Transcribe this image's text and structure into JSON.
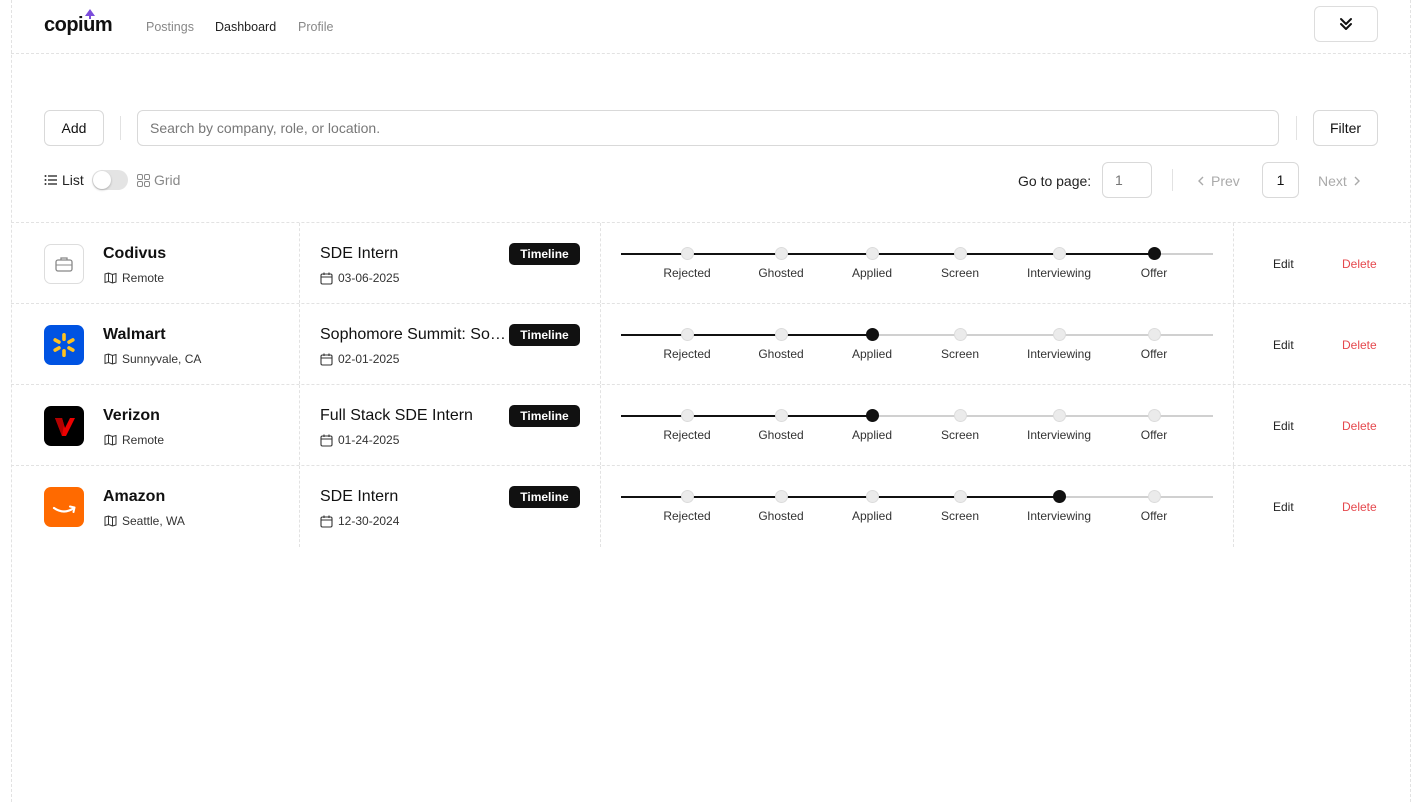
{
  "app": {
    "logo": "copium"
  },
  "nav": [
    {
      "label": "Postings",
      "active": false
    },
    {
      "label": "Dashboard",
      "active": true
    },
    {
      "label": "Profile",
      "active": false
    }
  ],
  "toolbar": {
    "add_label": "Add",
    "search_placeholder": "Search by company, role, or location.",
    "search_value": "",
    "filter_label": "Filter"
  },
  "view": {
    "list_label": "List",
    "grid_label": "Grid",
    "mode": "list"
  },
  "pagination": {
    "go_to_label": "Go to page:",
    "input_placeholder": "1",
    "prev_label": "Prev",
    "current_page": "1",
    "next_label": "Next"
  },
  "stages": [
    "Rejected",
    "Ghosted",
    "Applied",
    "Screen",
    "Interviewing",
    "Offer"
  ],
  "applications": [
    {
      "company": "Codivus",
      "location": "Remote",
      "role": "SDE Intern",
      "date": "03-06-2025",
      "badge": "Timeline",
      "stage": "Offer",
      "logo": "briefcase-icon",
      "edit": "Edit",
      "delete": "Delete"
    },
    {
      "company": "Walmart",
      "location": "Sunnyvale, CA",
      "role": "Sophomore Summit: Software Engineering",
      "date": "02-01-2025",
      "badge": "Timeline",
      "stage": "Applied",
      "logo": "walmart-spark-icon",
      "edit": "Edit",
      "delete": "Delete"
    },
    {
      "company": "Verizon",
      "location": "Remote",
      "role": "Full Stack SDE Intern",
      "date": "01-24-2025",
      "badge": "Timeline",
      "stage": "Applied",
      "logo": "verizon-check-icon",
      "edit": "Edit",
      "delete": "Delete"
    },
    {
      "company": "Amazon",
      "location": "Seattle, WA",
      "role": "SDE Intern",
      "date": "12-30-2024",
      "badge": "Timeline",
      "stage": "Interviewing",
      "logo": "amazon-smile-icon",
      "edit": "Edit",
      "delete": "Delete"
    }
  ],
  "colors": {
    "accent": "#7c4ddb",
    "danger": "#e5484d",
    "badge_bg": "#111111"
  }
}
